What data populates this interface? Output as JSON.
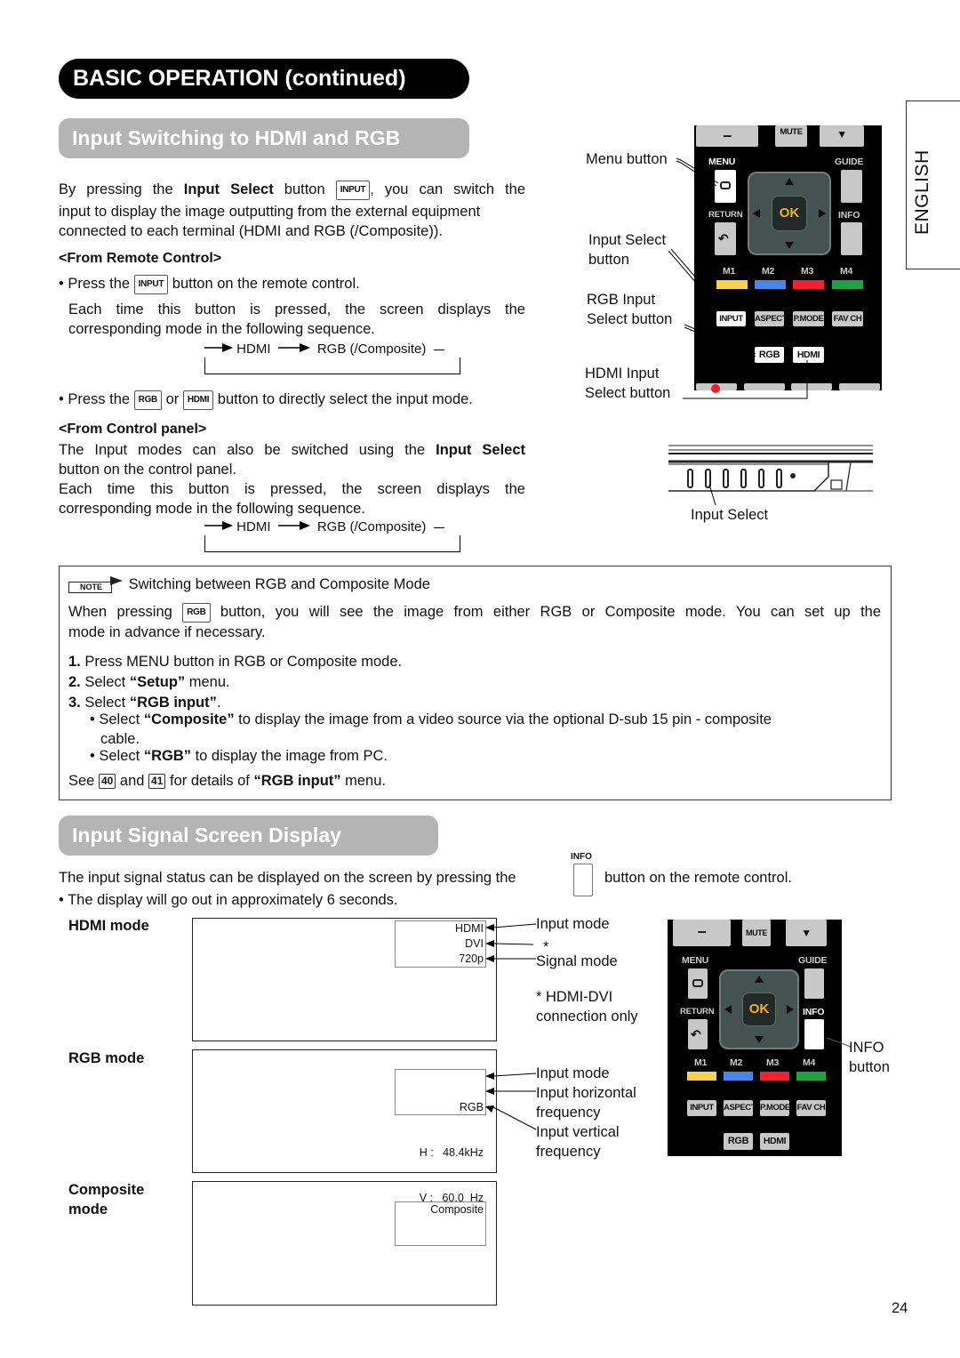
{
  "page": {
    "banner_title": "BASIC OPERATION (continued)",
    "language_tab": "ENGLISH",
    "page_number": "24"
  },
  "section1": {
    "title": "Input Switching to HDMI and RGB",
    "intro_pre": "By pressing the",
    "intro_bold": "Input Select",
    "intro_mid": "button",
    "intro_key": "INPUT",
    "intro_post": ", you can switch the",
    "intro_line2": "input to display the image outputting from the external equipment",
    "intro_line3": "connected to each terminal (HDMI and RGB (/Composite)).",
    "remote_heading": "<From Remote Control>",
    "remote_bullet1_pre": "• Press the",
    "remote_bullet1_key": "INPUT",
    "remote_bullet1_post": "button on the remote control.",
    "remote_desc_line1": "Each time this button is pressed, the screen displays the",
    "remote_desc_line2": "corresponding mode in the following sequence.",
    "sequence": [
      "HDMI",
      "RGB (/Composite)"
    ],
    "remote_bullet2_pre": "• Press the",
    "remote_bullet2_key1": "RGB",
    "remote_bullet2_or": "or",
    "remote_bullet2_key2": "HDMI",
    "remote_bullet2_post": "button to directly select the input mode.",
    "panel_heading": "<From Control panel>",
    "panel_line1_pre": "The Input modes can also be switched using the",
    "panel_line1_bold": "Input Select",
    "panel_line2": "button on the control panel.",
    "panel_line3": "Each time this button is pressed, the screen displays the",
    "panel_line4": "corresponding mode in the following sequence.",
    "panel_sequence": [
      "HDMI",
      "RGB (/Composite)"
    ]
  },
  "remote_top": {
    "callouts": {
      "menu": "Menu button",
      "input_select_1": "Input Select",
      "input_select_2": "button",
      "rgb_1": "RGB Input",
      "rgb_2": "Select button",
      "hdmi_1": "HDMI Input",
      "hdmi_2": "Select button"
    },
    "buttons": {
      "vol_down": "–",
      "mute": "MUTE",
      "ch_down": "▼",
      "menu": "MENU",
      "guide": "GUIDE",
      "return": "RETURN",
      "info": "INFO",
      "ok": "OK",
      "m1": "M1",
      "m2": "M2",
      "m3": "M3",
      "m4": "M4",
      "input": "INPUT",
      "aspect": "ASPECT",
      "pmode": "P.MODE",
      "favch": "FAV CH",
      "rgb": "RGB",
      "hdmi": "HDMI"
    },
    "colors": {
      "m1": "#f6d153",
      "m2": "#4a86e8",
      "m3": "#ee2233",
      "m4": "#22a045",
      "ok_text": "#f3b21a"
    }
  },
  "control_panel": {
    "callout": "Input Select"
  },
  "note": {
    "badge": "NOTE",
    "title": "Switching between RGB and Composite Mode",
    "line1_pre": "When pressing",
    "line1_key": "RGB",
    "line1_post": "button, you will see the image from either RGB or Composite mode. You can set up the",
    "line2": "mode in advance if necessary.",
    "steps": [
      {
        "num": "1.",
        "text": "Press MENU button in RGB or Composite mode."
      },
      {
        "num": "2.",
        "pre": "Select ",
        "bold": "“Setup”",
        "post": " menu."
      },
      {
        "num": "3.",
        "pre": "Select ",
        "bold": "“RGB input”",
        "post": "."
      }
    ],
    "sub_bullets": [
      {
        "pre": "• Select ",
        "bold": "“Composite”",
        "post": " to display the image from a video source via the optional D-sub 15 pin - composite",
        "cont": "cable."
      },
      {
        "pre": "• Select ",
        "bold": "“RGB”",
        "post": " to display the image from PC."
      }
    ],
    "see_pre": "See",
    "see_page1": "40",
    "see_and": "and",
    "see_page2": "41",
    "see_post_pre": "for details of",
    "see_bold": "“RGB input”",
    "see_post": "menu."
  },
  "section2": {
    "title": "Input Signal Screen Display",
    "intro_pre": "The input signal status can be displayed on the screen by pressing the",
    "info_key_label": "INFO",
    "intro_post": "button on the remote control.",
    "bullet": "• The display will go out in approximately 6 seconds.",
    "modes": [
      {
        "label": "HDMI mode",
        "osd": [
          "HDMI",
          "DVI",
          "720p"
        ]
      },
      {
        "label": "RGB mode",
        "osd": [
          "RGB",
          "H :   48.4kHz",
          "V :   60.0  Hz"
        ]
      },
      {
        "label_1": "Composite",
        "label_2": "mode",
        "osd": [
          "Composite"
        ]
      }
    ],
    "hdmi_callouts": {
      "input_mode": "Input mode",
      "asterisk": "*",
      "signal_mode": "Signal mode",
      "footnote_1": "* HDMI-DVI",
      "footnote_2": "connection only"
    },
    "rgb_callouts": {
      "input_mode": "Input mode",
      "h_freq_1": "Input horizontal",
      "h_freq_2": "frequency",
      "v_freq_1": "Input vertical",
      "v_freq_2": "frequency"
    },
    "info_callout_1": "INFO",
    "info_callout_2": "button"
  }
}
